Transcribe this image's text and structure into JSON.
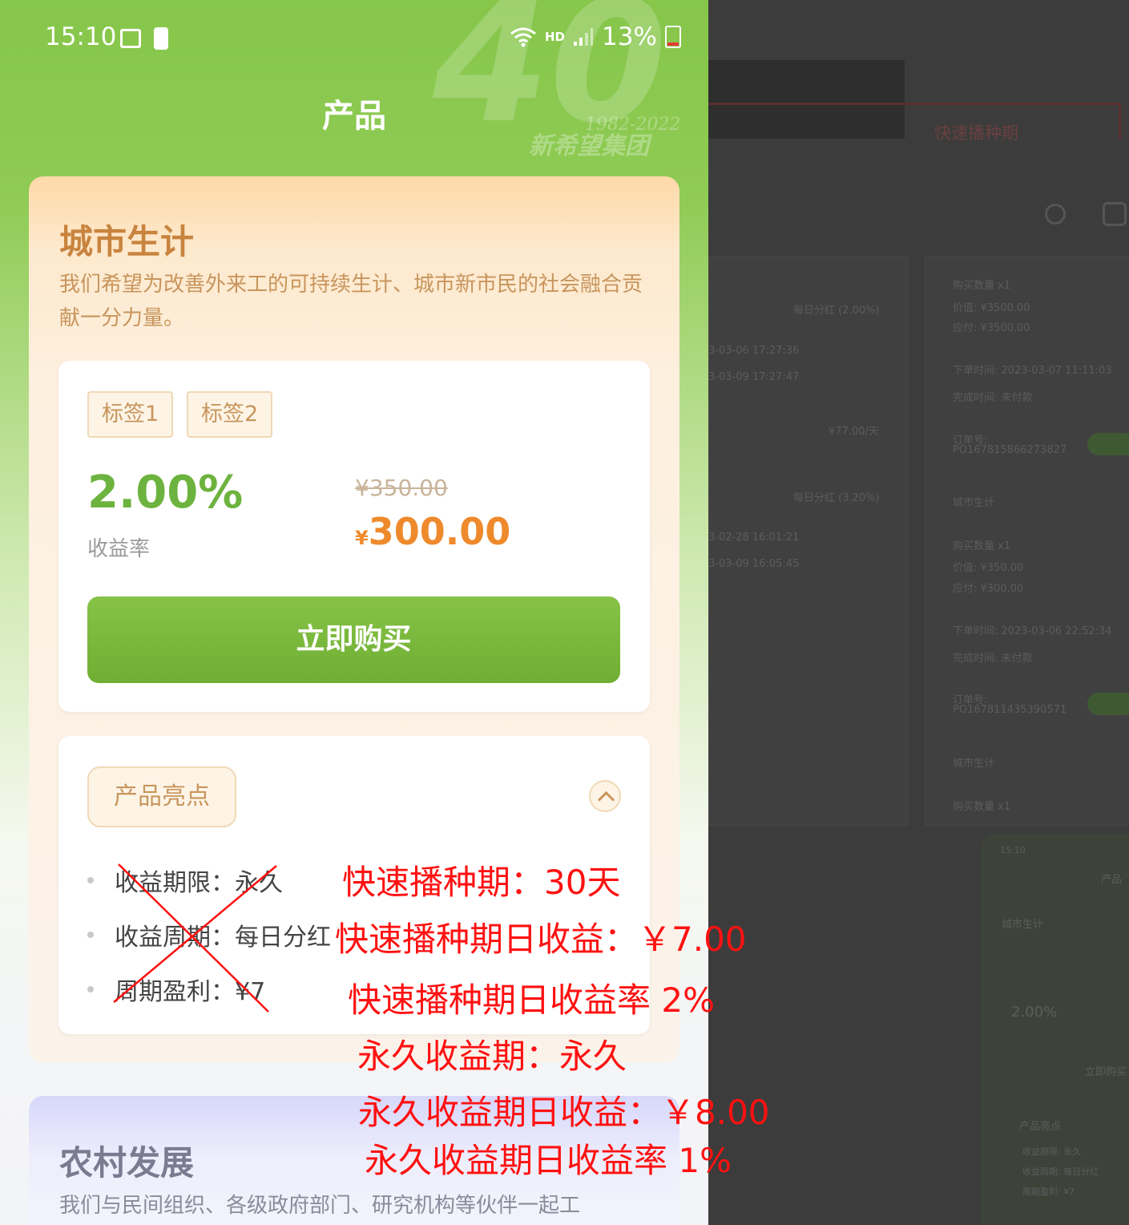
{
  "status_bar": {
    "time": "15:10",
    "network": "HD",
    "battery": "13%"
  },
  "watermark": {
    "number": "40",
    "years": "1982-2022",
    "org": "新希望集团"
  },
  "header": {
    "title": "产品"
  },
  "city_card": {
    "title": "城市生计",
    "description": "我们希望为改善外来工的可持续生计、城市新市民的社会融合贡献一分力量。",
    "tags": [
      "标签1",
      "标签2"
    ],
    "rate_value": "2.00%",
    "rate_label": "收益率",
    "original_price": "¥350.00",
    "currency": "¥",
    "price": "300.00",
    "buy_label": "立即购买",
    "highlights_title": "产品亮点",
    "highlights": [
      "收益期限：永久",
      "收益周期：每日分红",
      "周期盈利：¥7"
    ]
  },
  "rural_card": {
    "title": "农村发展",
    "description": "我们与民间组织、各级政府部门、研究机构等伙伴一起工"
  },
  "background_app": {
    "tab_label": "快速播种期",
    "left_panel": [
      "每日分红 (2.00%)",
      "3-03-06 17:27:36",
      "3-03-09 17:27:47",
      "¥77.00/天",
      "每日分红 (3.20%)",
      "3-02-28 16:01:21",
      "3-03-09 16:05:45"
    ],
    "right_panel": [
      "购买数量 x1",
      "价值: ¥3500.00",
      "应付: ¥3500.00",
      "下单时间: 2023-03-07 11:11:03",
      "完成时间: 未付款",
      "订单号:",
      "PO167815866273827",
      "城市生计",
      "购买数量 x1",
      "价值: ¥350.00",
      "应付: ¥300.00",
      "下单时间: 2023-03-06 22:52:34",
      "完成时间: 未付款",
      "订单号:",
      "PO167811435390571",
      "城市生计",
      "购买数量 x1"
    ],
    "mini_phone": [
      "15:10",
      "产品",
      "城市生计",
      "2.00%",
      "立即购买",
      "产品亮点",
      "收益期限: 永久",
      "收益周期: 每日分红",
      "周期盈利: ¥7"
    ]
  },
  "annotations": [
    "快速播种期：30天",
    "快速播种期日收益：￥7.00",
    "快速播种期日收益率  2%",
    "永久收益期：永久",
    "永久收益期日收益：￥8.00",
    "永久收益期日收益率 1%"
  ],
  "colors": {
    "header_green": "#86c64a",
    "rate_green": "#6db33f",
    "price_orange": "#ee8a2c",
    "annotation_red": "#ff1111"
  }
}
